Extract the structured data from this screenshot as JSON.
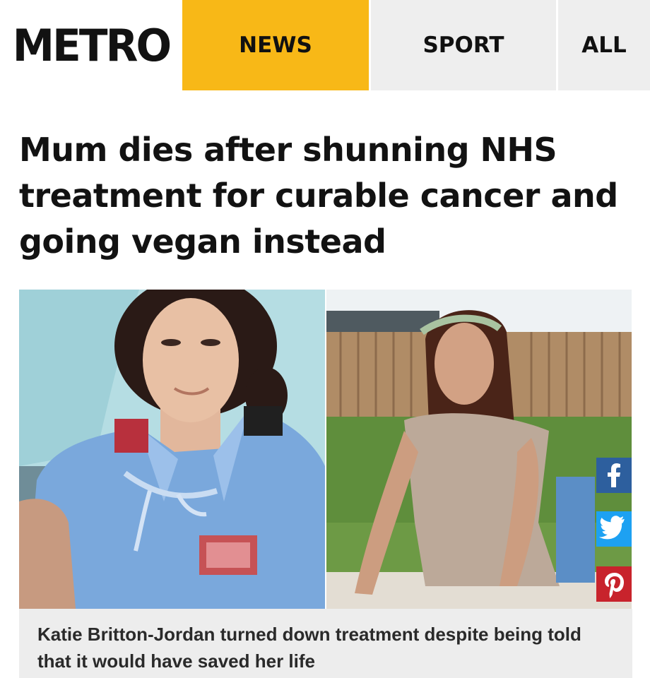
{
  "header": {
    "logo": "METRO",
    "tabs": [
      {
        "label": "NEWS",
        "active": true
      },
      {
        "label": "SPORT",
        "active": false
      },
      {
        "label": "ALL",
        "active": false
      }
    ],
    "active_color": "#f8b817"
  },
  "article": {
    "headline": "Mum dies after shunning NHS treatment for curable cancer and going vegan instead",
    "caption": "Katie Britton-Jordan turned down treatment despite being told that it would have saved her life"
  },
  "share": {
    "icons": [
      "facebook-icon",
      "twitter-icon",
      "pinterest-icon"
    ],
    "colors": {
      "facebook": "#2d5f9e",
      "twitter": "#1da1f2",
      "pinterest": "#c8232c"
    }
  }
}
